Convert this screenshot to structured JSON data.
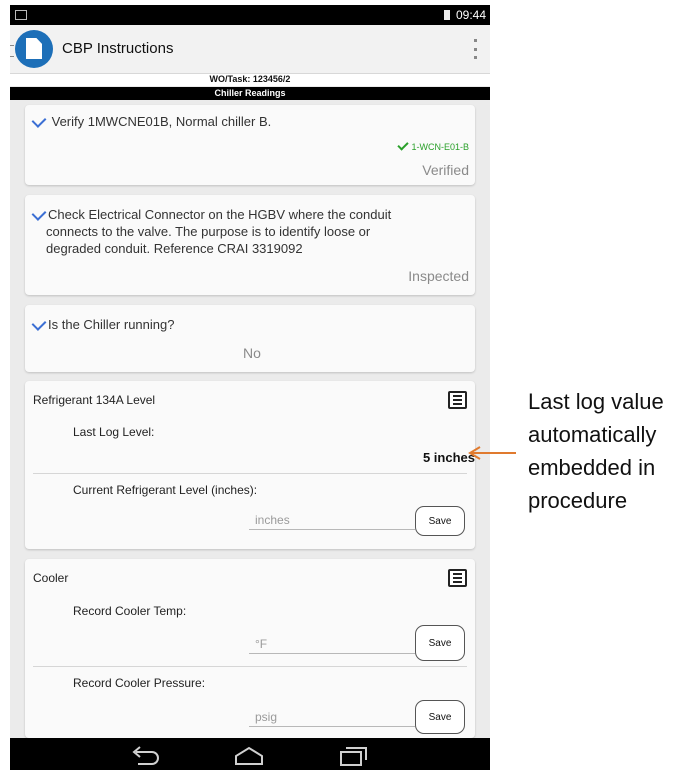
{
  "status_bar": {
    "time": "09:44"
  },
  "app": {
    "title": "CBP Instructions"
  },
  "task_line": "WO/Task: 123456/2",
  "section_title": "Chiller Readings",
  "steps": [
    {
      "text": "Verify 1MWCNE01B, Normal chiller B.",
      "tag": "1-WCN-E01-B",
      "status": "Verified"
    },
    {
      "text_lines": [
        "Check Electrical Connector on the HGBV where the conduit",
        "connects to the valve. The purpose is to identify loose or",
        "degraded conduit. Reference CRAI 3319092"
      ],
      "status": "Inspected"
    },
    {
      "text": "Is the Chiller running?",
      "answer": "No"
    }
  ],
  "refrigerant_card": {
    "title": "Refrigerant 134A Level",
    "last_log_label": "Last Log Level:",
    "last_log_value": "5 inches",
    "current_label": "Current Refrigerant Level (inches):",
    "current_placeholder": "inches",
    "save_label": "Save"
  },
  "cooler_card": {
    "title": "Cooler",
    "temp_label": "Record Cooler Temp:",
    "temp_placeholder": "°F",
    "pressure_label": "Record Cooler Pressure:",
    "pressure_placeholder": "psig",
    "save_label": "Save"
  },
  "annotation": {
    "lines": [
      "Last log value",
      "automatically",
      "embedded in",
      "procedure"
    ],
    "arrow_color": "#e07a2e"
  },
  "colors": {
    "check_blue": "#3b6fd4",
    "verified_green": "#2aa02a",
    "app_icon": "#1d6fb8"
  },
  "icons": [
    "window-icon",
    "battery-icon",
    "app-document-icon",
    "overflow-menu-icon",
    "check-icon",
    "log-icon",
    "back-icon",
    "home-icon",
    "recents-icon"
  ]
}
